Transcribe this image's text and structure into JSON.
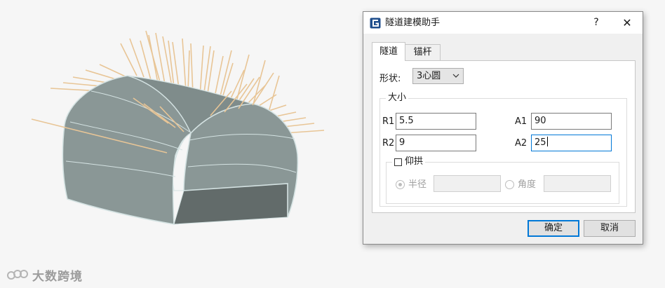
{
  "dialog": {
    "title": "隧道建模助手",
    "help_glyph": "?",
    "close_glyph": "✕",
    "tabs": [
      {
        "label": "隧道",
        "active": true
      },
      {
        "label": "锚杆",
        "active": false
      }
    ],
    "shape": {
      "label": "形状:",
      "selected": "3心圆"
    },
    "size_group": {
      "legend": "大小",
      "fields": {
        "R1": {
          "label": "R1",
          "value": "5.5"
        },
        "A1": {
          "label": "A1",
          "value": "90"
        },
        "R2": {
          "label": "R2",
          "value": "9"
        },
        "A2": {
          "label": "A2",
          "value": "25"
        }
      }
    },
    "arch_group": {
      "legend": "仰拱",
      "checked": false,
      "radius_label": "半径",
      "angle_label": "角度",
      "radius_selected": true
    },
    "buttons": {
      "ok": "确定",
      "cancel": "取消"
    }
  },
  "watermark": {
    "text": "大数跨境"
  },
  "colors": {
    "tunnel_surface": "#8a9796",
    "tunnel_edge": "#d4e2e2",
    "bolts": "#e8c596",
    "accent": "#0078d7"
  }
}
